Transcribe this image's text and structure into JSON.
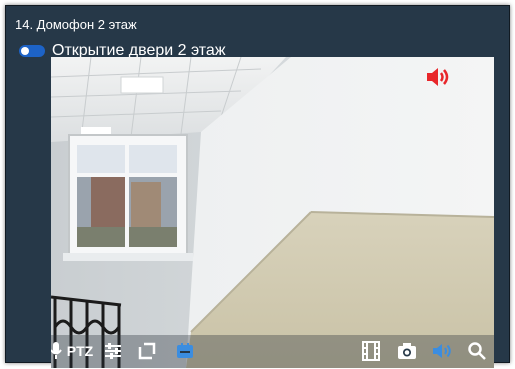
{
  "camera": {
    "title": "14. Домофон 2 этаж"
  },
  "door_toggle": {
    "label": "Открытие двери 2 этаж",
    "state": "on"
  },
  "video": {
    "sound_icon": "volume-icon",
    "sound_icon_color": "#e8262a"
  },
  "toolbar": {
    "ptz_label": "PTZ",
    "left_icons": [
      "microphone-icon",
      "ptz-button",
      "settings-sliders-icon",
      "frame-icon",
      "archive-icon"
    ],
    "right_icons": [
      "film-icon",
      "camera-icon",
      "volume-icon",
      "search-icon"
    ],
    "active_color": "#3b8de0"
  },
  "colors": {
    "panel_bg": "#263848",
    "toggle_accent": "#1d63c7"
  }
}
